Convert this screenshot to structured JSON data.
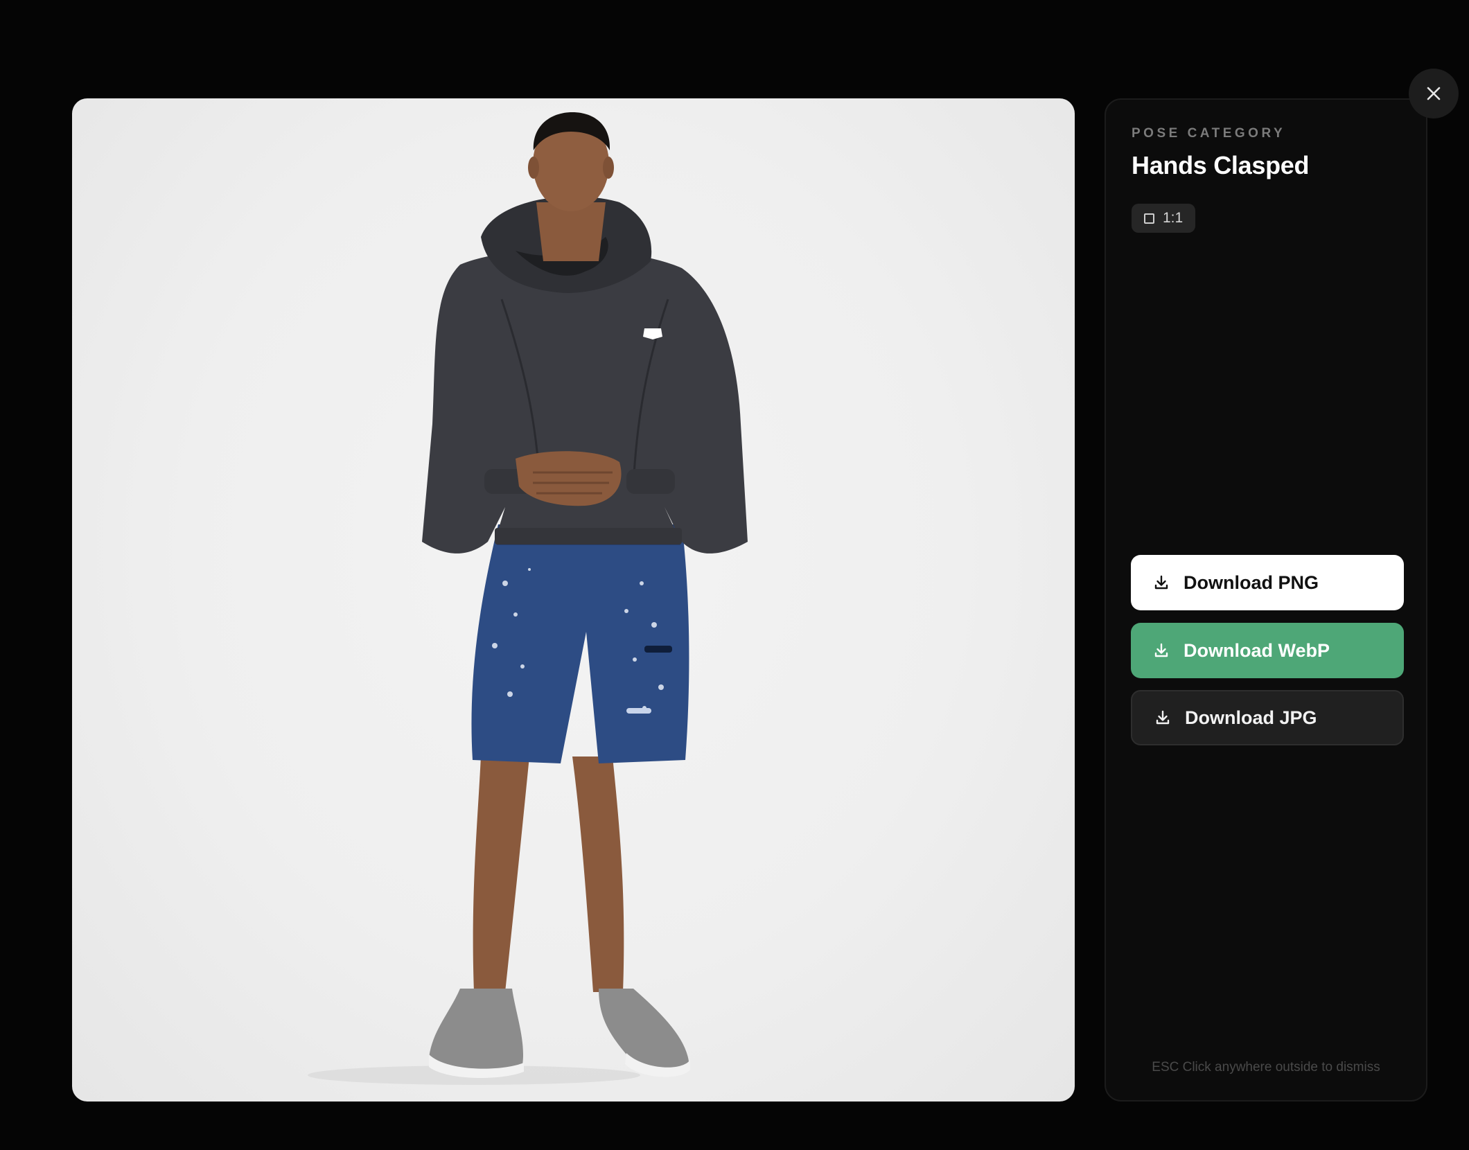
{
  "viewer": {
    "image_alt": "Model in dark hoodie and distressed denim shorts with hands clasped",
    "panel": {
      "eyebrow": "POSE CATEGORY",
      "pose_title": "Hands Clasped",
      "ratio_label": "1:1",
      "ratio_icon": "square-icon"
    },
    "buttons": [
      {
        "label": "Download PNG",
        "icon": "download-icon",
        "style": "light"
      },
      {
        "label": "Download WebP",
        "icon": "download-icon",
        "style": "accent"
      },
      {
        "label": "Download JPG",
        "icon": "download-icon",
        "style": "dark"
      }
    ],
    "hint": "ESC Click anywhere outside to dismiss",
    "close_icon": "close-icon"
  },
  "colors": {
    "accent": "#4ea777",
    "panel_bg": "#0c0c0c",
    "overlay_bg": "#050505",
    "photo_bg": "#efefef"
  }
}
